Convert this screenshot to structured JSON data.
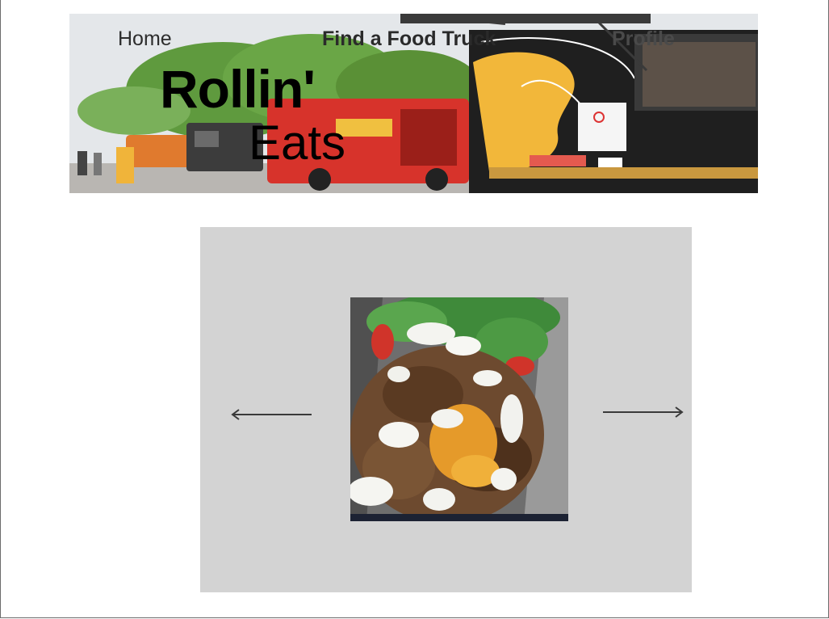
{
  "nav": {
    "home_label": "Home",
    "find_label": "Find a Food Truck",
    "profile_label": "Profile"
  },
  "brand": {
    "line1": "Rollin'",
    "line2": "Eats"
  },
  "colors": {
    "carousel_background": "#d3d3d3",
    "arrow": "#3a3a3a"
  },
  "icons": {
    "prev": "arrow-left-icon",
    "next": "arrow-right-icon"
  }
}
